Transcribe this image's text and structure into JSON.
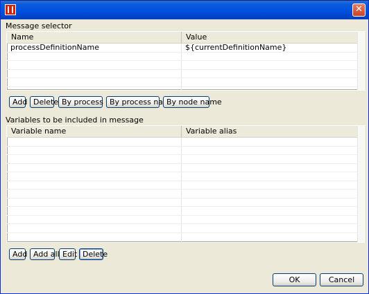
{
  "window": {
    "close_glyph": "✕",
    "app_icon": "red-app-icon"
  },
  "message_selector": {
    "label": "Message selector",
    "columns": [
      "Name",
      "Value"
    ],
    "rows": [
      {
        "name": "processDefinitionName",
        "value": "${currentDefinitionName}"
      },
      {
        "name": "",
        "value": ""
      },
      {
        "name": "",
        "value": ""
      },
      {
        "name": "",
        "value": ""
      },
      {
        "name": "",
        "value": ""
      },
      {
        "name": "",
        "value": ""
      }
    ],
    "buttons": {
      "add": "Add",
      "delete": "Delete",
      "by_process_id": "By process ID",
      "by_process_name": "By process name",
      "by_node_name": "By node name"
    }
  },
  "variables": {
    "label": "Variables to be included in message",
    "columns": [
      "Variable name",
      "Variable alias"
    ],
    "buttons": {
      "add": "Add",
      "add_all": "Add all",
      "edit": "Edit",
      "delete": "Delete"
    }
  },
  "dialog_buttons": {
    "ok": "OK",
    "cancel": "Cancel"
  }
}
